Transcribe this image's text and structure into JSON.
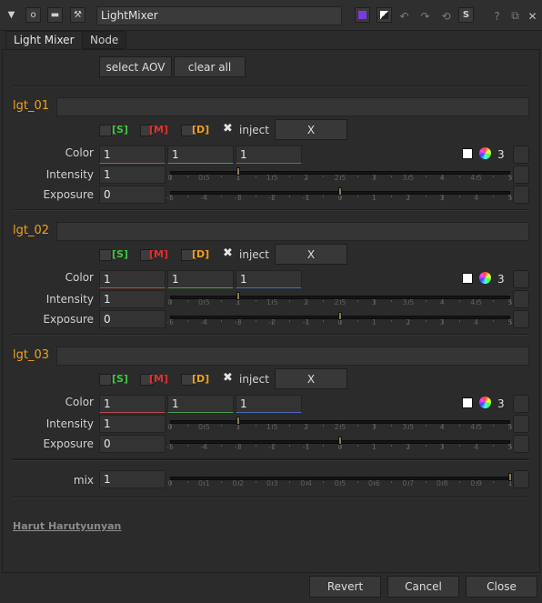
{
  "window": {
    "node_name": "LightMixer"
  },
  "tabs": [
    {
      "label": "Light Mixer"
    },
    {
      "label": "Node"
    }
  ],
  "toolbar": {
    "select_aov_label": "select AOV",
    "clear_all_label": "clear all"
  },
  "lights": [
    {
      "name": "lgt_01",
      "solo_label": "[S]",
      "mute_label": "[M]",
      "disable_label": "[D]",
      "inject_label": "inject",
      "x_label": "X",
      "color_label": "Color",
      "color": [
        "1",
        "1",
        "1"
      ],
      "channel_count": "3",
      "intensity_label": "Intensity",
      "intensity": "1",
      "exposure_label": "Exposure",
      "exposure": "0"
    },
    {
      "name": "lgt_02",
      "solo_label": "[S]",
      "mute_label": "[M]",
      "disable_label": "[D]",
      "inject_label": "inject",
      "x_label": "X",
      "color_label": "Color",
      "color": [
        "1",
        "1",
        "1"
      ],
      "channel_count": "3",
      "intensity_label": "Intensity",
      "intensity": "1",
      "exposure_label": "Exposure",
      "exposure": "0"
    },
    {
      "name": "lgt_03",
      "solo_label": "[S]",
      "mute_label": "[M]",
      "disable_label": "[D]",
      "inject_label": "inject",
      "x_label": "X",
      "color_label": "Color",
      "color": [
        "1",
        "1",
        "1"
      ],
      "channel_count": "3",
      "intensity_label": "Intensity",
      "intensity": "1",
      "exposure_label": "Exposure",
      "exposure": "0"
    }
  ],
  "intensity_scale": {
    "min": 0,
    "max": 5,
    "labels": [
      "0",
      "0.5",
      "1",
      "1.5",
      "2",
      "2.5",
      "3",
      "3.5",
      "4",
      "4.5",
      "5"
    ]
  },
  "exposure_scale": {
    "min": -5,
    "max": 5,
    "labels": [
      "-5",
      "-4",
      "-3",
      "-2",
      "-1",
      "0",
      "1",
      "2",
      "3",
      "4",
      "5"
    ]
  },
  "mix": {
    "label": "mix",
    "value": "1",
    "min": 0,
    "max": 1,
    "labels": [
      "0",
      "0.1",
      "0.2",
      "0.3",
      "0.4",
      "0.5",
      "0.6",
      "0.7",
      "0.8",
      "0.9",
      "1"
    ]
  },
  "author": "Harut Harutyunyan",
  "footer": {
    "revert_label": "Revert",
    "cancel_label": "Cancel",
    "close_label": "Close"
  },
  "colors": {
    "accent_orange": "#f0a020",
    "solo_green": "#3cc83c",
    "mute_red": "#e03030",
    "disable_orange": "#f0a020",
    "handle": "#8a7a50"
  }
}
